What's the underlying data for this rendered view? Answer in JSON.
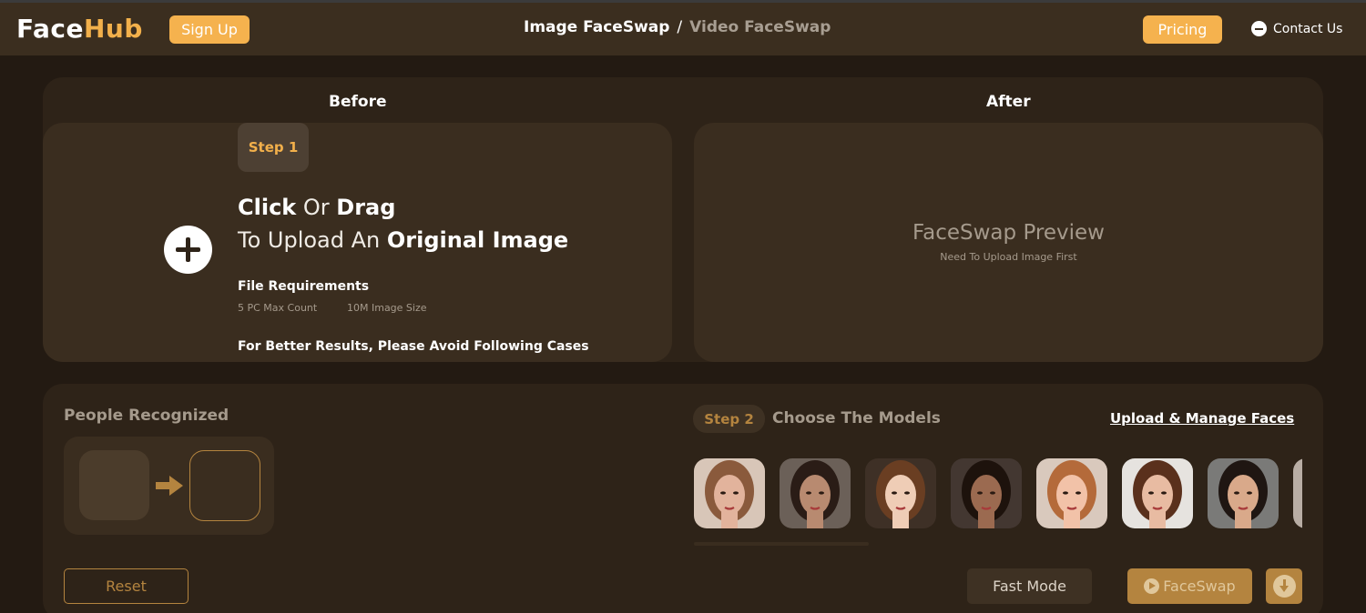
{
  "header": {
    "logo_part1": "Face",
    "logo_part2": "Hub",
    "signup_label": "Sign Up",
    "nav_active": "Image FaceSwap",
    "nav_separator": "/",
    "nav_inactive": "Video FaceSwap",
    "pricing_label": "Pricing",
    "contact_label": "Contact Us"
  },
  "before": {
    "title": "Before",
    "step_label": "Step 1",
    "click": "Click",
    "or": " Or ",
    "drag": "Drag",
    "to_upload": "To Upload An ",
    "original_image": "Original Image",
    "requirements_title": "File Requirements",
    "req_count": "5 PC Max Count",
    "req_size": "10M Image Size",
    "avoid_text": "For Better Results, Please Avoid Following Cases"
  },
  "after": {
    "title": "After",
    "preview_title": "FaceSwap Preview",
    "preview_subtitle": "Need To Upload Image First"
  },
  "people": {
    "title": "People Recognized"
  },
  "models": {
    "step_label": "Step 2",
    "title": "Choose The Models",
    "manage_link": "Upload & Manage Faces",
    "items": [
      {
        "name": "model-1",
        "skin": "#e2b39c",
        "hair": "#8a5a3c",
        "bg": "#d8c6b8"
      },
      {
        "name": "model-2",
        "skin": "#b88a70",
        "hair": "#2a1c16",
        "bg": "#6b6058"
      },
      {
        "name": "model-3",
        "skin": "#efcdb6",
        "hair": "#6a3e22",
        "bg": "#3e3026"
      },
      {
        "name": "model-4",
        "skin": "#9b6a50",
        "hair": "#1d120c",
        "bg": "#433731"
      },
      {
        "name": "model-5",
        "skin": "#f2c2a8",
        "hair": "#b46a3a",
        "bg": "#d9c9bd"
      },
      {
        "name": "model-6",
        "skin": "#e8bba2",
        "hair": "#5a301c",
        "bg": "#e6e3df"
      },
      {
        "name": "model-7",
        "skin": "#d9a98a",
        "hair": "#1f1612",
        "bg": "#7a7a78"
      },
      {
        "name": "model-8",
        "skin": "#c9997c",
        "hair": "#3a2416",
        "bg": "#b8ada4"
      }
    ]
  },
  "actions": {
    "reset_label": "Reset",
    "fast_mode_label": "Fast Mode",
    "faceswap_label": "FaceSwap"
  }
}
